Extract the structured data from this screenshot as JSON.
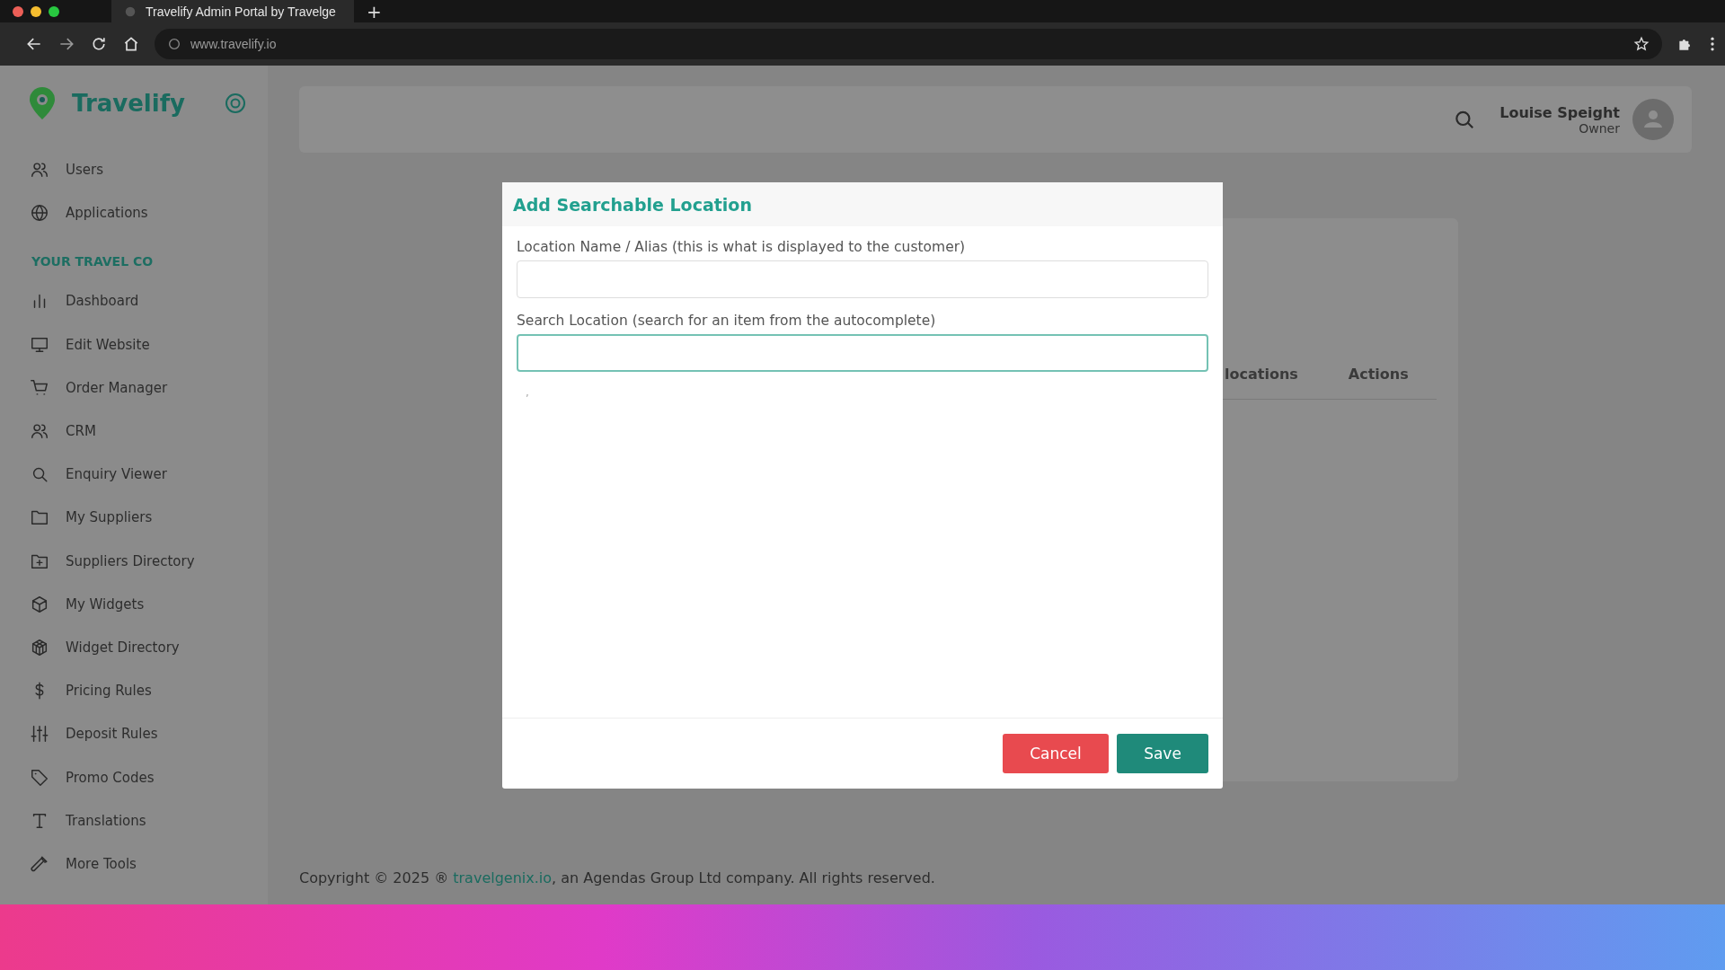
{
  "browser": {
    "tab_title": "Travelify Admin Portal by Travelge",
    "new_tab": "+",
    "url": "www.travelify.io"
  },
  "sidebar": {
    "brand": "Travelify",
    "sections": [
      {
        "items": [
          {
            "label": "Users"
          },
          {
            "label": "Applications"
          }
        ]
      },
      {
        "title": "YOUR TRAVEL CO",
        "items": [
          {
            "label": "Dashboard"
          },
          {
            "label": "Edit Website"
          },
          {
            "label": "Order Manager"
          },
          {
            "label": "CRM"
          },
          {
            "label": "Enquiry Viewer"
          },
          {
            "label": "My Suppliers"
          },
          {
            "label": "Suppliers Directory"
          },
          {
            "label": "My Widgets"
          },
          {
            "label": "Widget Directory"
          },
          {
            "label": "Pricing Rules"
          },
          {
            "label": "Deposit Rules"
          },
          {
            "label": "Promo Codes"
          },
          {
            "label": "Translations"
          },
          {
            "label": "More Tools"
          }
        ]
      }
    ]
  },
  "header": {
    "user_name": "Louise Speight",
    "user_role": "Owner"
  },
  "table": {
    "columns": [
      "locations",
      "Actions"
    ]
  },
  "footer": {
    "prefix": "Copyright © 2025 ®",
    "link": "travelgenix.io",
    "suffix": ", an Agendas Group Ltd company. All rights reserved."
  },
  "modal": {
    "title": "Add Searchable Location",
    "fields": [
      {
        "label": "Location Name / Alias (this is what is displayed to the customer)",
        "focused": false
      },
      {
        "label": "Search Location (search for an item from the autocomplete)",
        "focused": true
      }
    ],
    "stray_mark": ",",
    "buttons": [
      {
        "label": "Cancel",
        "kind": "danger"
      },
      {
        "label": "Save",
        "kind": "primary"
      }
    ]
  }
}
